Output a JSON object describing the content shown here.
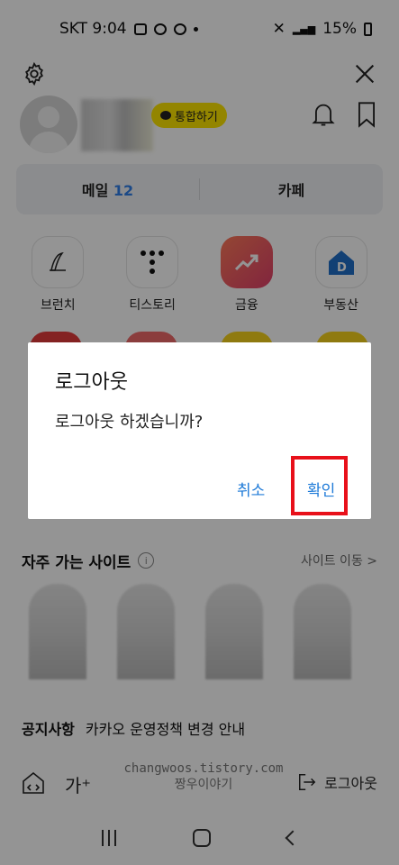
{
  "status_bar": {
    "carrier_time": "SKT 9:04",
    "battery": "15%"
  },
  "profile": {
    "merge_label": "통합하기"
  },
  "mail_bar": {
    "mail_label": "메일",
    "mail_count": "12",
    "cafe_label": "카페"
  },
  "services": [
    {
      "label": "브런치",
      "icon": "pen-icon"
    },
    {
      "label": "티스토리",
      "icon": "tistory-icon"
    },
    {
      "label": "금융",
      "icon": "chart-up-icon"
    },
    {
      "label": "부동산",
      "icon": "house-icon"
    }
  ],
  "frequent_sites": {
    "title": "자주 가는 사이트",
    "move_label": "사이트 이동 >"
  },
  "notice": {
    "label": "공지사항",
    "text": "카카오 운영정책 변경 안내"
  },
  "bottom_tools": {
    "font_label": "가⁺",
    "logout_label": "로그아웃"
  },
  "watermark": {
    "line1": "changwoos.tistory.com",
    "line2": "짱우이야기"
  },
  "dialog": {
    "title": "로그아웃",
    "message": "로그아웃 하겠습니까?",
    "cancel_label": "취소",
    "ok_label": "확인",
    "highlight_color": "#e8101a"
  }
}
